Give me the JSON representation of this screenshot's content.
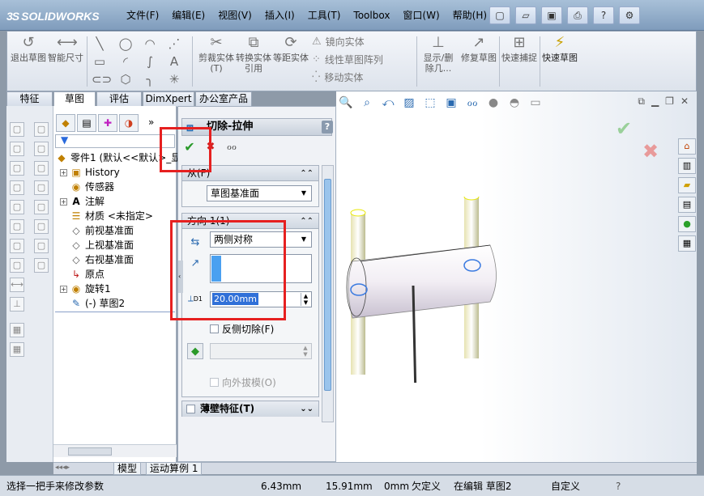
{
  "app": {
    "logo_text": "SOLIDWORKS"
  },
  "menu": [
    "文件(F)",
    "编辑(E)",
    "视图(V)",
    "插入(I)",
    "工具(T)",
    "Toolbox",
    "窗口(W)",
    "帮助(H)"
  ],
  "cmdbar": {
    "exit_sketch": "退出草图",
    "smart_dim": "智能尺寸",
    "trim": "剪裁实体(T)",
    "convert": "转换实体引用",
    "offset": "等距实体",
    "mirror": "镜向实体",
    "linear_pattern": "线性草图阵列",
    "move": "移动实体",
    "show_delete": "显示/删除几...",
    "repair": "修复草图",
    "quick_snap": "快速捕捉",
    "rapid_sketch": "快速草图"
  },
  "tabs": [
    "特征",
    "草图",
    "评估",
    "DimXpert",
    "办公室产品"
  ],
  "active_tab": "草图",
  "tree": {
    "part": "零件1 (默认<<默认>_显",
    "items": [
      "History",
      "传感器",
      "注解",
      "材质 <未指定>",
      "前视基准面",
      "上视基准面",
      "右视基准面",
      "原点",
      "旋转1",
      "(-) 草图2"
    ]
  },
  "pm": {
    "title": "切除-拉伸",
    "help": "?",
    "from_label": "从(F)",
    "from_value": "草图基准面",
    "dir_label": "方向 1(1)",
    "end_condition": "两侧对称",
    "depth": "20.00mm",
    "depth_tag": "D1",
    "flip_side": "反侧切除(F)",
    "draft_outward": "向外拔模(O)",
    "thin_feature": "薄壁特征(T)"
  },
  "bottom_tabs": [
    "模型",
    "运动算例 1"
  ],
  "status": {
    "hint": "选择一把手来修改参数",
    "x": "6.43mm",
    "y": "15.91mm",
    "z": "0mm",
    "state": "欠定义",
    "editing": "在编辑 草图2",
    "custom": "自定义"
  },
  "colors": {
    "accent": "#e62020",
    "scroll": "#9ac4ec",
    "ok": "#2a9a2a"
  }
}
